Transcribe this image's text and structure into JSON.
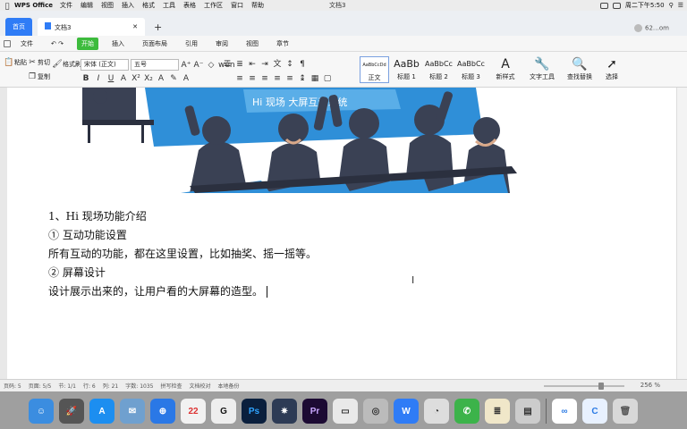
{
  "menubar": {
    "app_name": "WPS Office",
    "items": [
      "文件",
      "编辑",
      "视图",
      "插入",
      "格式",
      "工具",
      "表格",
      "工作区",
      "窗口",
      "帮助"
    ],
    "window_title": "文档3",
    "clock": "周二下午5:50"
  },
  "tabs": {
    "home": "首页",
    "doc": "文档3",
    "plus": "+",
    "account": "62…om"
  },
  "ribbon": {
    "tabs": [
      "文件",
      "开始",
      "插入",
      "页面布局",
      "引用",
      "审阅",
      "视图",
      "章节"
    ],
    "active": "开始"
  },
  "toolbar": {
    "paste": "粘贴",
    "cut": "剪切",
    "copy": "复制",
    "format_painter": "格式刷",
    "font_name": "宋体 (正文)",
    "font_size": "五号",
    "styles": [
      {
        "sample": "AaBbCcDd",
        "label": "正文"
      },
      {
        "sample": "AaBb",
        "label": "标题 1"
      },
      {
        "sample": "AaBbCc",
        "label": "标题 2"
      },
      {
        "sample": "AaBbCc",
        "label": "标题 3"
      }
    ],
    "new_style": "新样式",
    "text_tools": "文字工具",
    "find_replace": "查找替换",
    "select": "选择"
  },
  "illustration": {
    "banner_text": "Hi 现场  大屏互动系统"
  },
  "document": {
    "lines": [
      "1、Hi 现场功能介绍",
      "① 互动功能设置",
      "所有互动的功能，都在这里设置，比如抽奖、摇一摇等。",
      "② 屏幕设计",
      "设计展示出来的，让用户看的大屏幕的造型。"
    ]
  },
  "statusbar": {
    "page": "页码: 5",
    "pages": "页面: 5/5",
    "section": "节: 1/1",
    "row": "行: 6",
    "col": "列: 21",
    "words": "字数: 1035",
    "spell": "拼写检查",
    "doc_check": "文档校对",
    "backup": "本地备份",
    "zoom": "256 %"
  },
  "dock": {
    "calendar_day": "22"
  },
  "colors": {
    "accent": "#2f7cf6",
    "ribbon_active": "#3dbb3d",
    "illustration_dark": "#3a4154",
    "illustration_blue": "#2f8fd8"
  }
}
